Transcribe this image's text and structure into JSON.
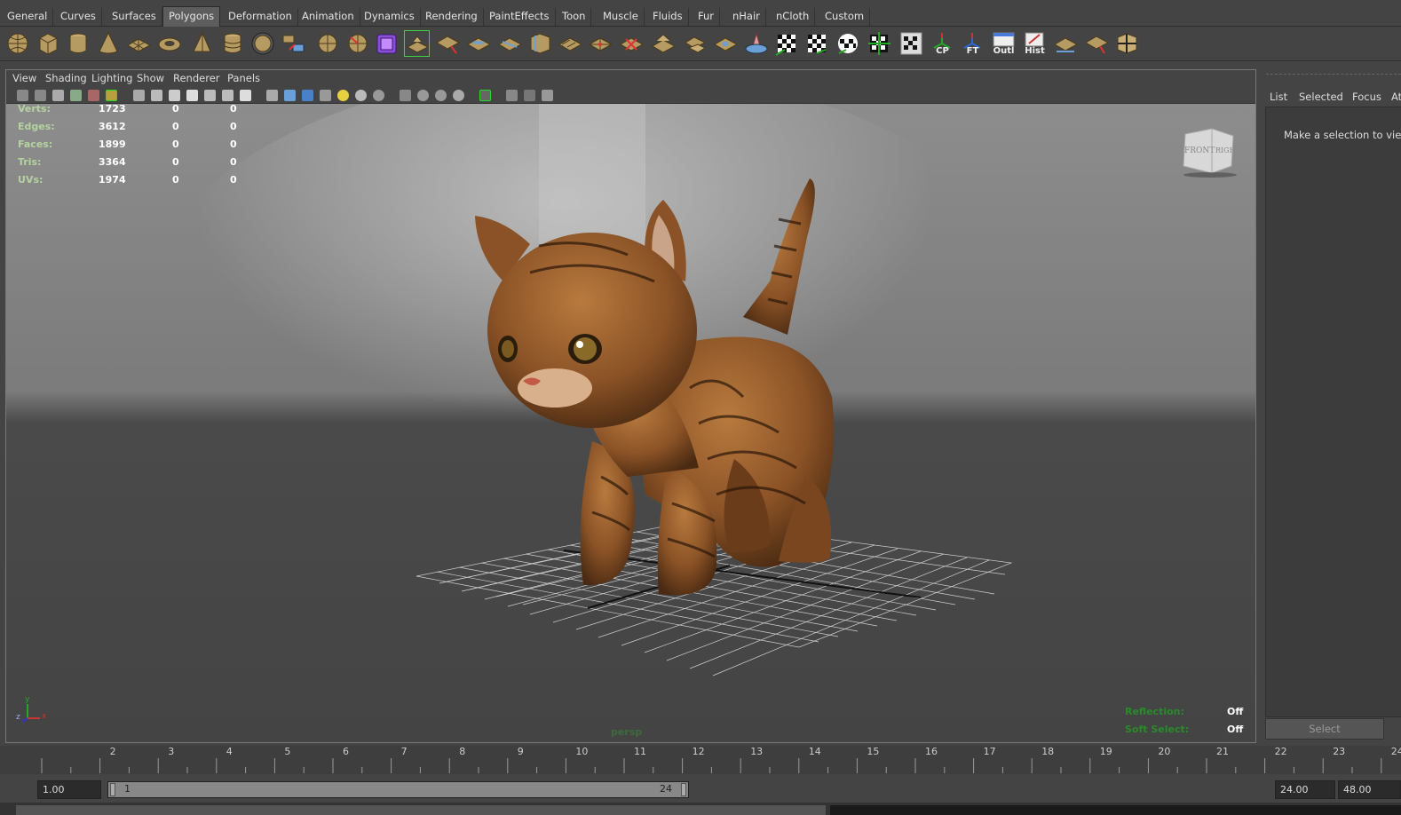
{
  "shelf_tabs": [
    "General",
    "Curves",
    "Surfaces",
    "Polygons",
    "Deformation",
    "Animation",
    "Dynamics",
    "Rendering",
    "PaintEffects",
    "Toon",
    "Muscle",
    "Fluids",
    "Fur",
    "nHair",
    "nCloth",
    "Custom"
  ],
  "active_shelf_tab": "Polygons",
  "shelf_icon_labels": {
    "cp": "CP",
    "ft": "FT",
    "outl": "Outl",
    "hist": "Hist"
  },
  "viewport": {
    "menu": [
      "View",
      "Shading",
      "Lighting",
      "Show",
      "Renderer",
      "Panels"
    ],
    "camera": "persp",
    "viewcube": {
      "front": "FRONT",
      "right": "RIGHT"
    },
    "axis": {
      "y": "y",
      "z": "z",
      "x": "x"
    },
    "hud_stats": [
      {
        "label": "Verts:",
        "a": "1723",
        "b": "0",
        "c": "0"
      },
      {
        "label": "Edges:",
        "a": "3612",
        "b": "0",
        "c": "0"
      },
      {
        "label": "Faces:",
        "a": "1899",
        "b": "0",
        "c": "0"
      },
      {
        "label": "Tris:",
        "a": "3364",
        "b": "0",
        "c": "0"
      },
      {
        "label": "UVs:",
        "a": "1974",
        "b": "0",
        "c": "0"
      }
    ],
    "reflection": {
      "label": "Reflection:",
      "value": "Off"
    },
    "soft_select": {
      "label": "Soft Select:",
      "value": "Off"
    },
    "colors": {
      "hud_label": "#b4d2a0",
      "hud_green": "#2a8a2a"
    }
  },
  "right_panel": {
    "menu": [
      "List",
      "Selected",
      "Focus",
      "Attributes"
    ],
    "message": "Make a selection to view attributes",
    "select_button": "Select"
  },
  "timeline": {
    "ticks": [
      "2",
      "3",
      "4",
      "5",
      "6",
      "7",
      "8",
      "9",
      "10",
      "11",
      "12",
      "13",
      "14",
      "15",
      "16",
      "17",
      "18",
      "19",
      "20",
      "21",
      "22",
      "23",
      "24"
    ],
    "start_time": "1.00",
    "range_start": "1",
    "range_end": "24",
    "end_time": "24.00",
    "end_playback": "48.00"
  }
}
